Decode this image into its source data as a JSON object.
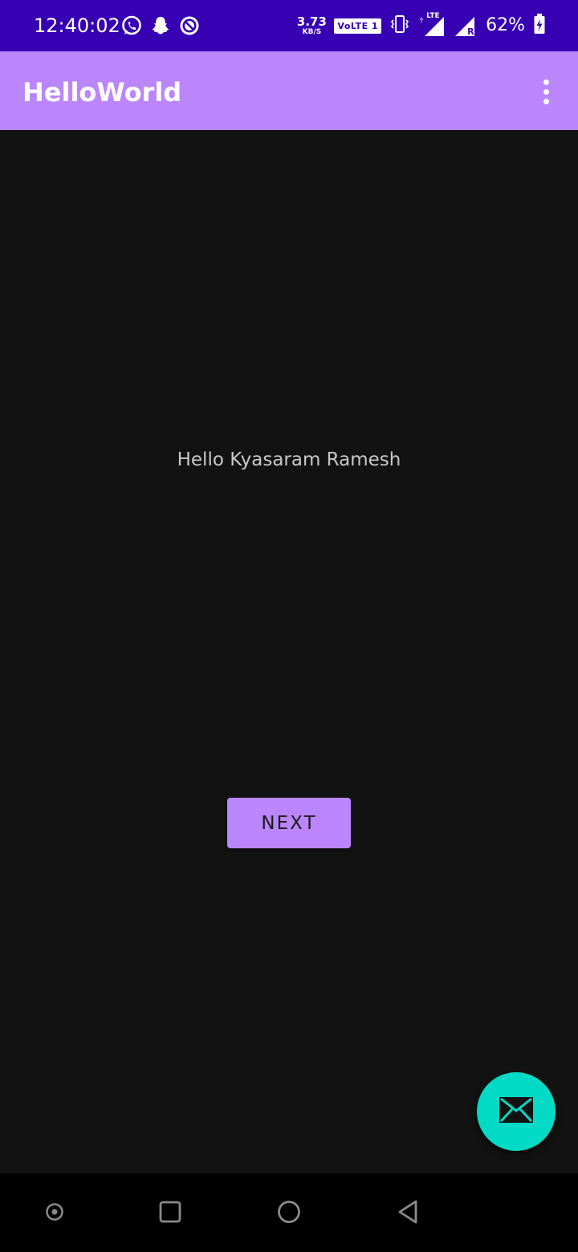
{
  "status_bar": {
    "time": "12:40:02",
    "net_speed_value": "3.73",
    "net_speed_unit": "KB/S",
    "volte_label": "VoLTE 1",
    "lte_label": "LTE",
    "roaming_label": "R",
    "battery_percent": "62%",
    "left_icons": [
      "whatsapp-icon",
      "snapchat-icon",
      "do-not-disturb-icon"
    ],
    "background_color": "#3700B3"
  },
  "app_bar": {
    "title": "HelloWorld",
    "background_color": "#BB86FC",
    "overflow_icon": "more-vert-icon"
  },
  "main": {
    "greeting": "Hello Kyasaram Ramesh",
    "next_button_label": "NEXT",
    "background_color": "#121212"
  },
  "fab": {
    "icon": "email-icon",
    "background_color": "#03DAC5"
  },
  "nav_bar": {
    "buttons": [
      "assistant-dot-icon",
      "recents-square-icon",
      "home-circle-icon",
      "back-triangle-icon"
    ]
  }
}
